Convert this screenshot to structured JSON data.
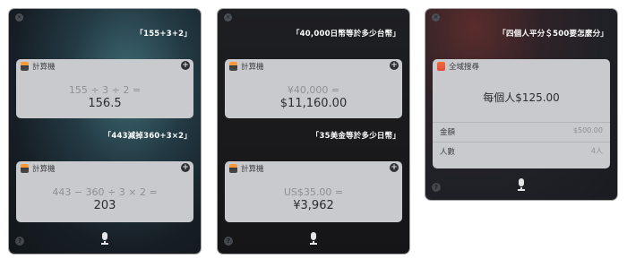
{
  "panels": [
    {
      "queries": [
        "「155+3+2」",
        "「443減掉360+3×2」"
      ],
      "cards": [
        {
          "app": "計算機",
          "expression": "155 ÷ 3 ÷ 2 =",
          "result": "156.5"
        },
        {
          "app": "計算機",
          "expression": "443 − 360 ÷ 3 × 2 =",
          "result": "203"
        }
      ]
    },
    {
      "queries": [
        "「40,000日幣等於多少台幣」",
        "「35美金等於多少日幣」"
      ],
      "cards": [
        {
          "app": "計算機",
          "expression": "¥40,000 =",
          "result": "$11,160.00"
        },
        {
          "app": "計算機",
          "expression": "US$35.00 =",
          "result": "¥3,962"
        }
      ]
    },
    {
      "query": "「四個人平分＄500要怎麼分」",
      "card": {
        "app": "全域搜尋",
        "headline": "每個人$125.00",
        "rows": [
          {
            "label": "金額",
            "value": "$500.00"
          },
          {
            "label": "人數",
            "value": "4人"
          }
        ]
      }
    }
  ],
  "icons": {
    "close": "close-icon",
    "help": "help-icon",
    "add": "plus-icon",
    "mic": "microphone-icon",
    "calculator": "calculator-app-icon",
    "spotlight": "spotlight-app-icon"
  },
  "glyphs": {
    "close": "×",
    "help": "?",
    "add": "+"
  }
}
